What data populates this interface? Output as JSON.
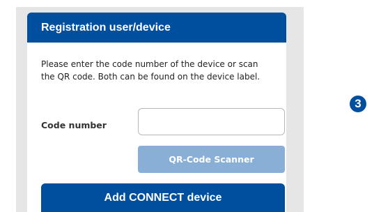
{
  "dialog": {
    "title": "Registration user/device",
    "instructions": "Please enter the code number of the device or scan the QR code. Both can be found on the device label.",
    "code_label": "Code number",
    "code_value": "",
    "qr_button_label": "QR-Code Scanner",
    "add_button_label": "Add CONNECT device"
  },
  "step_badge": {
    "number": "3"
  },
  "colors": {
    "primary": "#004f9f",
    "disabled_button": "#8aafd6",
    "panel_gray": "#e6e6e6"
  }
}
